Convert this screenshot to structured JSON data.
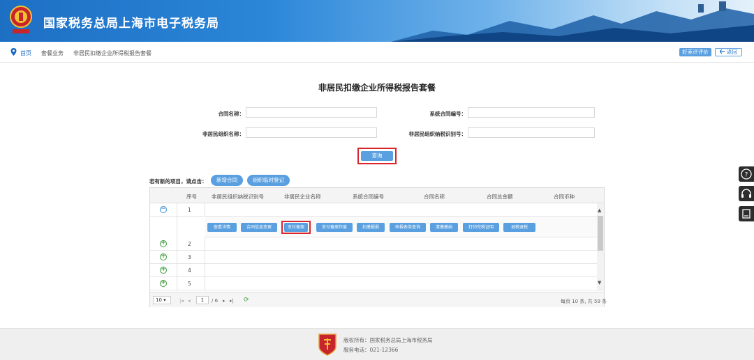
{
  "header": {
    "site_title": "国家税务总局上海市电子税务局",
    "brand_color": "#2b86d8"
  },
  "breadcrumb": {
    "home": "首页",
    "level1": "套餐业务",
    "level2": "非居民扣缴企业所得税报告套餐"
  },
  "top_buttons": {
    "rate": "好差评评价",
    "back": "返回"
  },
  "page_title": "非居民扣缴企业所得税报告套餐",
  "form": {
    "contract_name_label": "合同名称：",
    "system_contract_no_label": "系统合同编号：",
    "org_name_label": "非居民组织名称：",
    "org_tax_id_label": "非居民组织纳税识别号：",
    "search_button": "查询"
  },
  "new_item": {
    "hint": "若有新的项目，请点击：",
    "new_contract": "新增合同",
    "org_register": "组织临时登记"
  },
  "grid": {
    "columns": [
      "序号",
      "非居民组织纳税识别号",
      "非居民企业名称",
      "系统合同编号",
      "合同名称",
      "合同总金额",
      "合同币种"
    ],
    "rows": [
      "1",
      "2",
      "3",
      "4",
      "5"
    ],
    "actions": [
      "查看详情",
      "合同信息变更",
      "支付备案",
      "支付备案作废",
      "扣缴报报",
      "申报表单查询",
      "清缴缴纳",
      "打印完税证明",
      "退税退税"
    ],
    "highlighted_action": "支付备案"
  },
  "pager": {
    "page_size": "10",
    "current_page": "1",
    "total_pages": "/ 6",
    "summary": "每页 10 条, 共 59 条"
  },
  "footer": {
    "copyright": "版权所有：国家税务总局上海市税务局",
    "phone": "服务电话：021-12366"
  },
  "icons": {
    "pin": "map-pin-icon",
    "help": "help-icon",
    "headset": "headset-icon",
    "book": "book-icon",
    "refresh": "refresh-icon"
  }
}
